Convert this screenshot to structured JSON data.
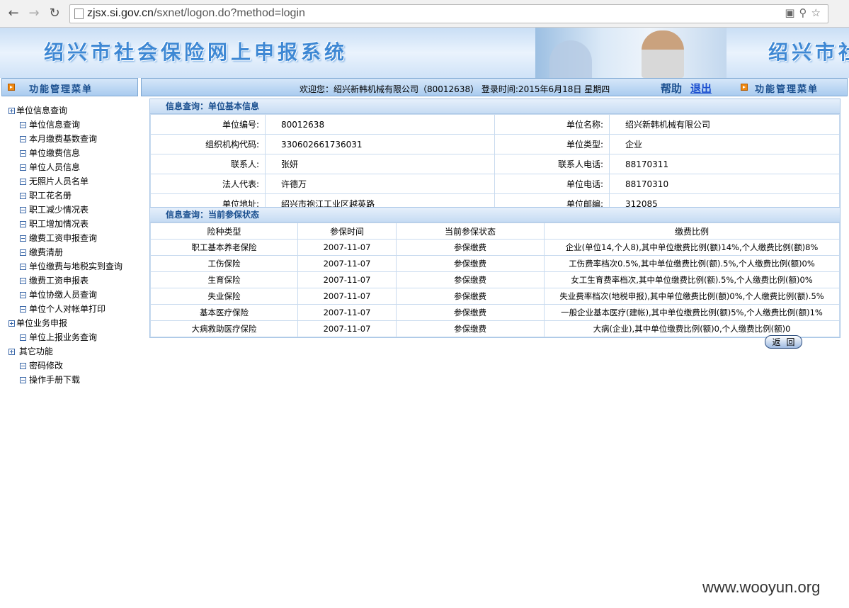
{
  "browser": {
    "url_host": "zjsx.si.gov.cn",
    "url_path": "/sxnet/logon.do?method=login"
  },
  "banner": {
    "title": "绍兴市社会保险网上申报系统",
    "title_repeat": "绍兴市社"
  },
  "menubar": {
    "left_label": "功能管理菜单",
    "right_label": "功能管理菜单",
    "welcome": "欢迎您：绍兴新韩机械有限公司（80012638）   登录时间:2015年6月18日   星期四",
    "help": "帮助",
    "logout": "退出"
  },
  "sidebar": {
    "groups": [
      {
        "label": "单位信息查询",
        "items": [
          "单位信息查询",
          "本月缴费基数查询",
          "单位缴费信息",
          "单位人员信息",
          "无照片人员名单",
          "职工花名册",
          "职工减少情况表",
          "职工增加情况表",
          "缴费工资申报查询",
          "缴费清册",
          "单位缴费与地税实到查询",
          "缴费工资申报表",
          "单位协缴人员查询",
          "单位个人对帐单打印"
        ]
      },
      {
        "label": "单位业务申报",
        "items": [
          "单位上报业务查询"
        ]
      },
      {
        "label": "其它功能",
        "items": [
          "密码修改",
          "操作手册下载"
        ]
      }
    ]
  },
  "basic_info": {
    "heading": "信息查询：单位基本信息",
    "rows": [
      {
        "l1": "单位编号:",
        "v1": "80012638",
        "l2": "单位名称:",
        "v2": "绍兴新韩机械有限公司"
      },
      {
        "l1": "组织机构代码:",
        "v1": "330602661736031",
        "l2": "单位类型:",
        "v2": "企业"
      },
      {
        "l1": "联系人:",
        "v1": "张妍",
        "l2": "联系人电话:",
        "v2": "88170311"
      },
      {
        "l1": "法人代表:",
        "v1": "许德万",
        "l2": "单位电话:",
        "v2": "88170310"
      },
      {
        "l1": "单位地址:",
        "v1": "绍兴市袍江工业区越英路",
        "l2": "单位邮编:",
        "v2": "312085"
      }
    ]
  },
  "insurance_status": {
    "heading": "信息查询：当前参保状态",
    "columns": [
      "险种类型",
      "参保时间",
      "当前参保状态",
      "缴费比例"
    ],
    "rows": [
      [
        "职工基本养老保险",
        "2007-11-07",
        "参保缴费",
        "企业(单位14,个人8),其中单位缴费比例(额)14%,个人缴费比例(额)8%"
      ],
      [
        "工伤保险",
        "2007-11-07",
        "参保缴费",
        "工伤费率档次0.5%,其中单位缴费比例(额).5%,个人缴费比例(额)0%"
      ],
      [
        "生育保险",
        "2007-11-07",
        "参保缴费",
        "女工生育费率档次,其中单位缴费比例(额).5%,个人缴费比例(额)0%"
      ],
      [
        "失业保险",
        "2007-11-07",
        "参保缴费",
        "失业费率档次(地税申报),其中单位缴费比例(额)0%,个人缴费比例(额).5%"
      ],
      [
        "基本医疗保险",
        "2007-11-07",
        "参保缴费",
        "一般企业基本医疗(建帐),其中单位缴费比例(额)5%,个人缴费比例(额)1%"
      ],
      [
        "大病救助医疗保险",
        "2007-11-07",
        "参保缴费",
        "大病(企业),其中单位缴费比例(额)0,个人缴费比例(额)0"
      ]
    ]
  },
  "back_button": "返回",
  "watermark": "www.wooyun.org"
}
